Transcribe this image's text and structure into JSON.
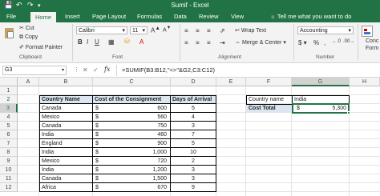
{
  "title": "Sumif - Excel",
  "tabs": [
    "File",
    "Home",
    "Insert",
    "Page Layout",
    "Formulas",
    "Data",
    "Review",
    "View"
  ],
  "tell_me": "Tell me what you want to do",
  "ribbon": {
    "cut": "Cut",
    "copy": "Copy",
    "format_painter": "Format Painter",
    "font_name": "Calibri",
    "font_size": "11",
    "wrap_text": "Wrap Text",
    "merge_center": "Merge & Center",
    "number_format": "Accounting",
    "conc": "Conc",
    "form": "Form",
    "groups": {
      "clipboard": "Clipboard",
      "font": "Font",
      "alignment": "Alignment",
      "number": "Number"
    }
  },
  "formula_bar": {
    "name_box": "G3",
    "fx": "fx",
    "formula": "=SUMIF(B3:B12,\"<>\"&G2,C3:C12)"
  },
  "columns": [
    "A",
    "B",
    "C",
    "D",
    "E",
    "F",
    "G",
    "H"
  ],
  "rows": [
    "1",
    "2",
    "3",
    "4",
    "5",
    "6",
    "7",
    "8",
    "9",
    "10",
    "11",
    "12",
    "13"
  ],
  "table": {
    "headers": [
      "Country Name",
      "Cost of the Consignment",
      "Days of Arrival"
    ],
    "rows": [
      {
        "country": "Canada",
        "cur": "$",
        "cost": "600",
        "days": "5"
      },
      {
        "country": "Mexico",
        "cur": "$",
        "cost": "560",
        "days": "4"
      },
      {
        "country": "Canada",
        "cur": "$",
        "cost": "750",
        "days": "3"
      },
      {
        "country": "India",
        "cur": "$",
        "cost": "460",
        "days": "7"
      },
      {
        "country": "England",
        "cur": "$",
        "cost": "900",
        "days": "5"
      },
      {
        "country": "India",
        "cur": "$",
        "cost": "1,000",
        "days": "10"
      },
      {
        "country": "Mexico",
        "cur": "$",
        "cost": "720",
        "days": "2"
      },
      {
        "country": "India",
        "cur": "$",
        "cost": "1,200",
        "days": "3"
      },
      {
        "country": "Canada",
        "cur": "$",
        "cost": "1,500",
        "days": "3"
      },
      {
        "country": "Africa",
        "cur": "$",
        "cost": "670",
        "days": "9"
      }
    ]
  },
  "lookup": {
    "country_label": "Country name",
    "country_value": "India",
    "cost_label": "Cost Total",
    "cost_cur": "$",
    "cost_value": "5,300"
  },
  "colors": {
    "excel_green": "#217346",
    "header_fill": "#dce6f1"
  }
}
